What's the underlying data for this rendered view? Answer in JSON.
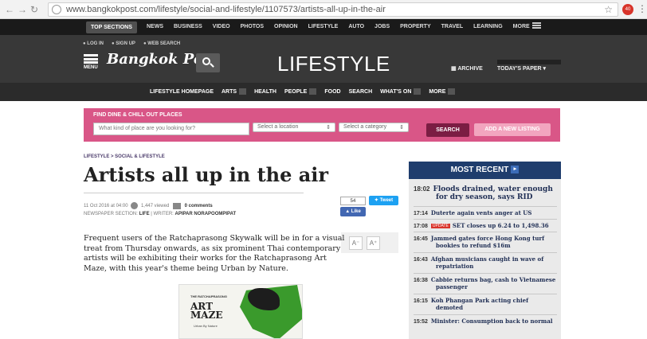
{
  "browser": {
    "url": "www.bangkokpost.com/lifestyle/social-and-lifestyle/1107573/artists-all-up-in-the-air",
    "ext_badge": "40"
  },
  "topbar": {
    "sections_label": "TOP SECTIONS",
    "items": [
      "NEWS",
      "BUSINESS",
      "VIDEO",
      "PHOTOS",
      "OPINION",
      "LIFESTYLE",
      "AUTO",
      "JOBS",
      "PROPERTY",
      "TRAVEL",
      "LEARNING",
      "MORE"
    ]
  },
  "header": {
    "login": "LOG IN",
    "signup": "SIGN UP",
    "websearch": "WEB SEARCH",
    "menu": "MENU",
    "logo": "Bangkok Post",
    "section": "LIFESTYLE",
    "archive": "ARCHIVE",
    "todays_paper": "TODAY'S PAPER"
  },
  "secnav": {
    "items": [
      {
        "label": "LIFESTYLE HOMEPAGE",
        "dropdown": false
      },
      {
        "label": "ARTS",
        "dropdown": true
      },
      {
        "label": "HEALTH",
        "dropdown": false
      },
      {
        "label": "PEOPLE",
        "dropdown": true
      },
      {
        "label": "FOOD",
        "dropdown": false
      },
      {
        "label": "SEARCH",
        "dropdown": false
      },
      {
        "label": "WHAT'S ON",
        "dropdown": true
      },
      {
        "label": "MORE",
        "dropdown": true
      }
    ]
  },
  "finder": {
    "title": "FIND DINE & CHILL OUT PLACES",
    "placeholder": "What kind of place are you looking for?",
    "location": "Select a location",
    "category": "Select a category",
    "search": "SEARCH",
    "add": "ADD A NEW LISTING"
  },
  "article": {
    "breadcrumb": "LIFESTYLE > SOCIAL & LIFESTYLE",
    "title": "Artists all up in the air",
    "date": "11 Oct 2016 at 04:00",
    "views": "1,447 viewed",
    "comments": "0 comments",
    "section_label": "NEWSPAPER SECTION:",
    "section": "LIFE",
    "writer_label": "WRITER:",
    "writer": "APIPAR NORAPOOMPIPAT",
    "like_count": "54",
    "like": "Like",
    "tweet": "Tweet",
    "body": "Frequent users of the Ratchaprasong Skywalk will be in for a visual treat from Thursday onwards, as six prominent Thai contemporary artists will be exhibiting their works for the Ratchaprasong Art Maze, with this year's theme being Urban by Nature.",
    "font_smaller": "A⁻",
    "font_larger": "A⁺"
  },
  "poster": {
    "small": "THE RATCHAPRASONG",
    "title_1": "ART",
    "title_2": "MAZE",
    "sub": "Urban By Nature"
  },
  "most_recent": {
    "heading": "MOST RECENT",
    "items": [
      {
        "time": "18:02",
        "text": "Floods drained, water enough",
        "text2": "for dry season, says RID"
      },
      {
        "time": "17:14",
        "text": "Duterte again vents anger at US"
      },
      {
        "time": "17:08",
        "badge": "UPDATE",
        "text": "SET closes up 6.24 to 1,498.36"
      },
      {
        "time": "16:45",
        "text": "Jammed gates force Hong Kong turf",
        "text2": "bookies to refund $16m"
      },
      {
        "time": "16:43",
        "text": "Afghan musicians caught in wave of",
        "text2": "repatriation"
      },
      {
        "time": "16:38",
        "text": "Cabbie returns bag, cash to Vietnamese",
        "text2": "passenger"
      },
      {
        "time": "16:15",
        "text": "Koh Phangan Park acting chief",
        "text2": "demoted"
      },
      {
        "time": "15:52",
        "text": "Minister: Consumption back to normal"
      }
    ]
  }
}
